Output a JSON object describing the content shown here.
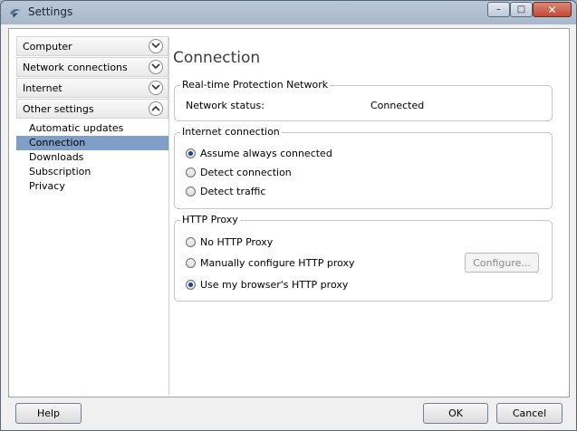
{
  "window": {
    "title": "Settings"
  },
  "titlebar": {
    "minimize": "–",
    "maximize": "□",
    "close": "✕"
  },
  "sidebar": {
    "sections": [
      {
        "label": "Computer",
        "expanded": false
      },
      {
        "label": "Network connections",
        "expanded": false
      },
      {
        "label": "Internet",
        "expanded": false
      },
      {
        "label": "Other settings",
        "expanded": true
      }
    ],
    "sub_items": [
      {
        "label": "Automatic updates",
        "selected": false
      },
      {
        "label": "Connection",
        "selected": true
      },
      {
        "label": "Downloads",
        "selected": false
      },
      {
        "label": "Subscription",
        "selected": false
      },
      {
        "label": "Privacy",
        "selected": false
      }
    ]
  },
  "main": {
    "heading": "Connection",
    "rpn_group": {
      "title": "Real-time Protection Network",
      "status_label": "Network status:",
      "status_value": "Connected"
    },
    "internet_group": {
      "title": "Internet connection",
      "options": [
        {
          "label": "Assume always connected",
          "checked": true
        },
        {
          "label": "Detect connection",
          "checked": false
        },
        {
          "label": "Detect traffic",
          "checked": false
        }
      ]
    },
    "proxy_group": {
      "title": "HTTP Proxy",
      "options": [
        {
          "label": "No HTTP Proxy",
          "checked": false
        },
        {
          "label": "Manually configure HTTP proxy",
          "checked": false
        },
        {
          "label": "Use my browser's HTTP proxy",
          "checked": true
        }
      ],
      "configure_label": "Configure..."
    }
  },
  "footer": {
    "help": "Help",
    "ok": "OK",
    "cancel": "Cancel"
  },
  "colors": {
    "selection": "#7f9fc6",
    "titlebar": "#b9c7d8",
    "close": "#c24a33"
  }
}
